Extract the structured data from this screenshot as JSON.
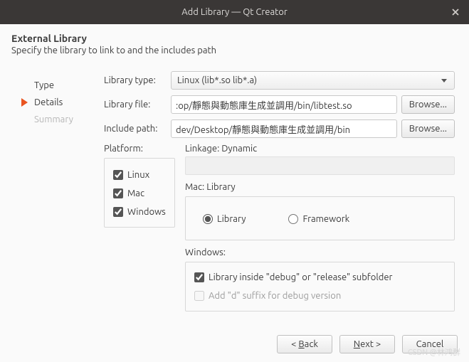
{
  "window": {
    "title": "Add Library — Qt Creator"
  },
  "header": {
    "title": "External Library",
    "subtitle": "Specify the library to link to and the includes path"
  },
  "sidebar": {
    "items": [
      "Type",
      "Details",
      "Summary"
    ]
  },
  "form": {
    "library_type_label": "Library type:",
    "library_type_value": "Linux (lib*.so lib*.a)",
    "library_file_label": "Library file:",
    "library_file_value": ":op/靜態與動態庫生成並調用/bin/libtest.so",
    "include_path_label": "Include path:",
    "include_path_value": "dev/Desktop/靜態與動態庫生成並調用/bin",
    "browse": "Browse...",
    "platform_label": "Platform:",
    "platforms": {
      "linux": "Linux",
      "mac": "Mac",
      "windows": "Windows"
    },
    "linkage_label": "Linkage: Dynamic",
    "mac_label": "Mac: Library",
    "mac_library": "Library",
    "mac_framework": "Framework",
    "windows_label": "Windows:",
    "win_subfolder": "Library inside \"debug\" or \"release\" subfolder",
    "win_suffix": "Add \"d\" suffix for debug version"
  },
  "footer": {
    "back_pre": "< ",
    "back_u": "B",
    "back_post": "ack",
    "next_pre": "",
    "next_u": "N",
    "next_post": "ext >",
    "cancel": "Cancel"
  },
  "watermark": "CSDN @林鸿群"
}
